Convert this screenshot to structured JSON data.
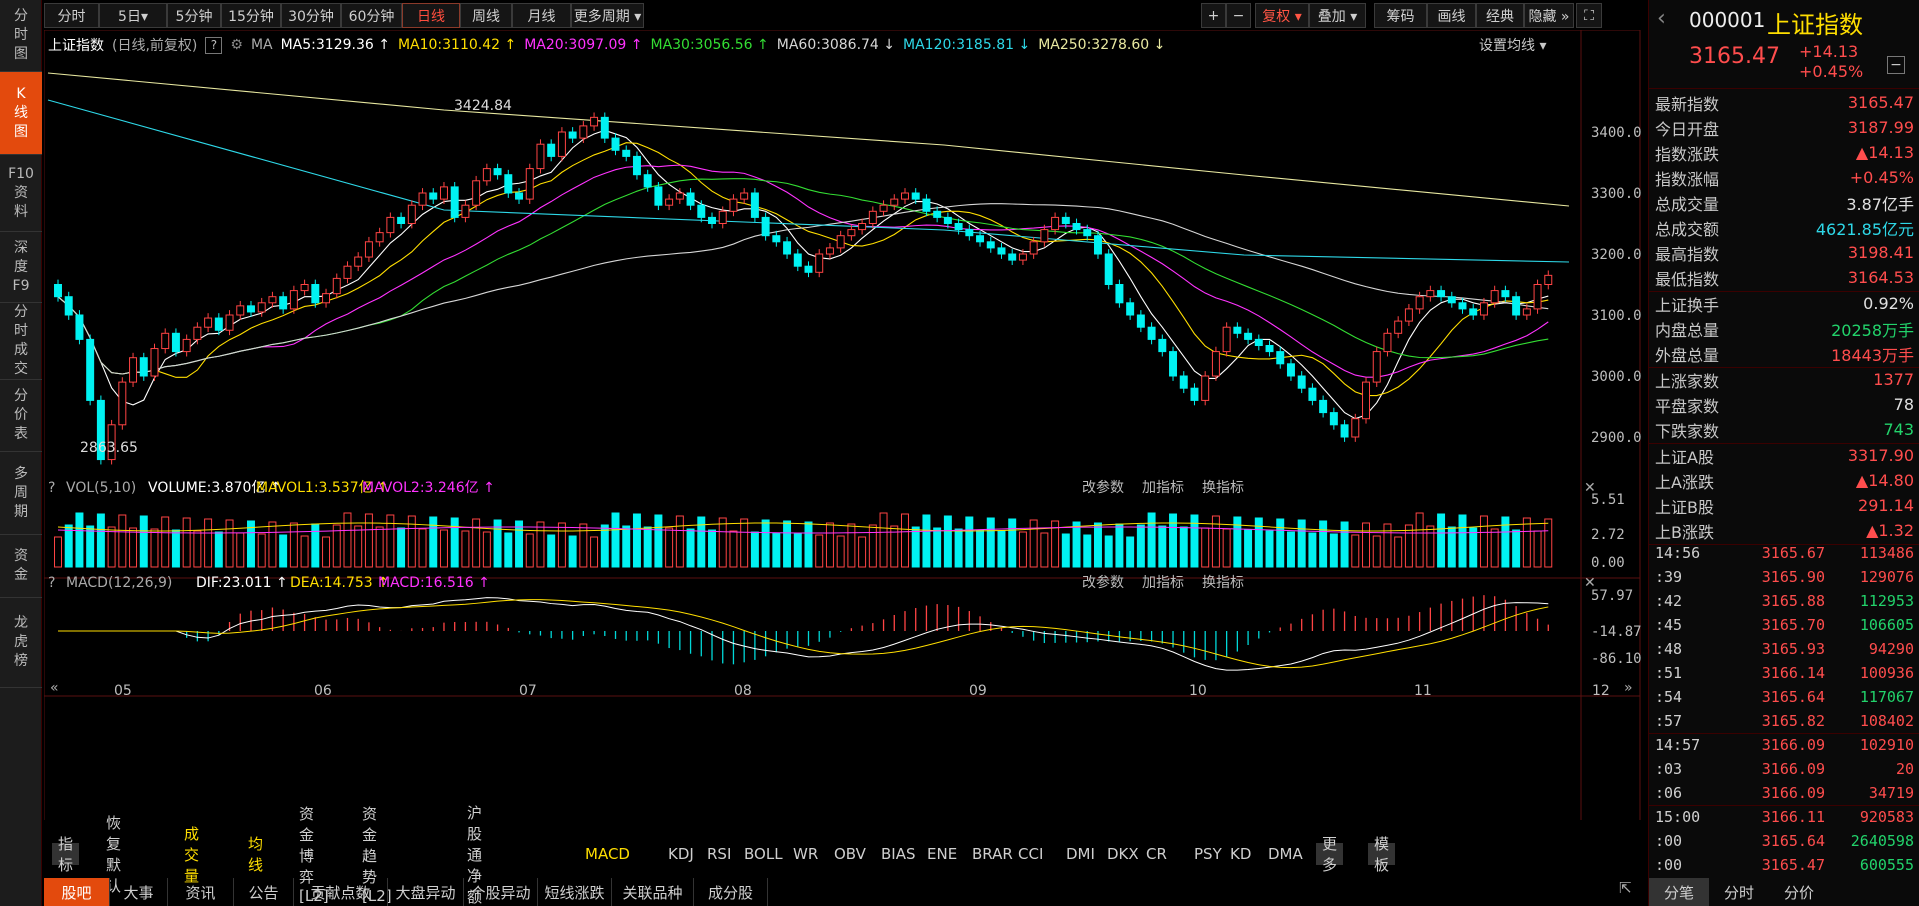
{
  "left_nav": [
    "分\n时\n图",
    "K\n线\n图",
    "F10\n资\n料",
    "深\n度\nF9",
    "分\n时\n成\n交",
    "分\n价\n表",
    "多\n周\n期",
    "资\n金",
    "龙\n虎\n榜"
  ],
  "toolbar": {
    "items": [
      "分时",
      "5日▾",
      "5分钟",
      "15分钟",
      "30分钟",
      "60分钟",
      "日线",
      "周线",
      "月线",
      "更多周期 ▾"
    ],
    "right": [
      "+",
      "−",
      "复权 ▾",
      "叠加 ▾",
      "筹码",
      "画线",
      "经典",
      "隐藏 »"
    ]
  },
  "main_header": {
    "name": "上证指数",
    "mode": "(日线,前复权)",
    "ma_label": "MA",
    "ma": [
      {
        "t": "MA5:3129.36 ↑",
        "c": "#ffffff"
      },
      {
        "t": "MA10:3110.42 ↑",
        "c": "#ffde00"
      },
      {
        "t": "MA20:3097.09 ↑",
        "c": "#ff33ff"
      },
      {
        "t": "MA30:3056.56 ↑",
        "c": "#33dd33"
      },
      {
        "t": "MA60:3086.74 ↓",
        "c": "#d6d6d6"
      },
      {
        "t": "MA120:3185.81 ↓",
        "c": "#2ed8e8"
      },
      {
        "t": "MA250:3278.60 ↓",
        "c": "#e8e8a0"
      }
    ],
    "settings": "设置均线 ▾"
  },
  "price_axis": [
    "3400.00",
    "3300.00",
    "3200.00",
    "3100.00",
    "3000.00",
    "2900.00"
  ],
  "annotations": {
    "high": "3424.84",
    "low": "2863.65"
  },
  "vol_header": {
    "label": "VOL(5,10)",
    "volume": "VOLUME:3.870亿 ↑",
    "mavol1": "MAVOL1:3.537亿 ↑",
    "mavol2": "MAVOL2:3.246亿 ↑"
  },
  "vol_axis": [
    "5.51",
    "2.72",
    "0.00"
  ],
  "macd_header": {
    "label": "MACD(12,26,9)",
    "dif": "DIF:23.011 ↑",
    "dea": "DEA:14.753 ↑",
    "macd": "MACD:16.516 ↑"
  },
  "macd_axis": [
    "57.97",
    "-14.87",
    "-86.10"
  ],
  "panel_actions": [
    "改参数",
    "加指标",
    "换指标"
  ],
  "x_axis": [
    "05",
    "06",
    "07",
    "08",
    "09",
    "10",
    "11",
    "12"
  ],
  "indicator_tabs": [
    "指标",
    "恢复默认",
    "成交量",
    "均线",
    "资金博弈[L2]",
    "资金趋势[L2]",
    "沪股通净额",
    "MACD",
    "KDJ",
    "RSI",
    "BOLL",
    "WR",
    "OBV",
    "BIAS",
    "ENE",
    "BRAR",
    "CCI",
    "DMI",
    "DKX",
    "CR",
    "PSY",
    "KD",
    "DMA",
    "更多",
    "模板"
  ],
  "bottom_tabs": [
    "股吧",
    "大事",
    "资讯",
    "公告",
    "贡献点数",
    "大盘异动",
    "个股异动",
    "短线涨跌",
    "关联品种",
    "成分股"
  ],
  "right_panel": {
    "code": "000001",
    "name": "上证指数",
    "price": "3165.47",
    "change": "+14.13",
    "pct": "+0.45%",
    "rows1": [
      [
        "最新指数",
        "3165.47",
        "up"
      ],
      [
        "今日开盘",
        "3187.99",
        "up"
      ],
      [
        "指数涨跌",
        "▲14.13",
        "up"
      ],
      [
        "指数涨幅",
        "+0.45%",
        "up"
      ],
      [
        "总成交量",
        "3.87亿手",
        "w"
      ],
      [
        "总成交额",
        "4621.85亿元",
        "cy"
      ],
      [
        "最高指数",
        "3198.41",
        "up"
      ],
      [
        "最低指数",
        "3164.53",
        "up"
      ]
    ],
    "rows2": [
      [
        "上证换手",
        "0.92%",
        "w"
      ],
      [
        "内盘总量",
        "20258万手",
        "dn"
      ],
      [
        "外盘总量",
        "18443万手",
        "up"
      ]
    ],
    "rows3": [
      [
        "上涨家数",
        "1377",
        "up"
      ],
      [
        "平盘家数",
        "78",
        "w"
      ],
      [
        "下跌家数",
        "743",
        "dn"
      ]
    ],
    "rows4": [
      [
        "上证A股",
        "3317.90",
        "up"
      ],
      [
        "上A涨跌",
        "▲14.80",
        "up"
      ],
      [
        "上证B股",
        "291.14",
        "up"
      ],
      [
        "上B涨跌",
        "▲1.32",
        "up"
      ]
    ],
    "ticks": [
      [
        "14:56",
        "3165.67",
        "113486",
        "up"
      ],
      [
        ":39",
        "3165.90",
        "129076",
        "up"
      ],
      [
        ":42",
        "3165.88",
        "112953",
        "dn"
      ],
      [
        ":45",
        "3165.70",
        "106605",
        "dn"
      ],
      [
        ":48",
        "3165.93",
        "94290",
        "up"
      ],
      [
        ":51",
        "3166.14",
        "100936",
        "up"
      ],
      [
        ":54",
        "3165.64",
        "117067",
        "dn"
      ],
      [
        ":57",
        "3165.82",
        "108402",
        "up"
      ],
      [
        "14:57",
        "3166.09",
        "102910",
        "up"
      ],
      [
        ":03",
        "3166.09",
        "20",
        "up"
      ],
      [
        ":06",
        "3166.09",
        "34719",
        "up"
      ],
      [
        "15:00",
        "3166.11",
        "920583",
        "up"
      ],
      [
        ":00",
        "3165.64",
        "2640598",
        "dn"
      ],
      [
        ":00",
        "3165.47",
        "600555",
        "dn"
      ]
    ],
    "tabs": [
      "分笔",
      "分时",
      "分价"
    ]
  },
  "chart_data": {
    "type": "candlestick",
    "closes": [
      3130,
      3100,
      3060,
      2960,
      2863,
      2920,
      2990,
      3030,
      3000,
      3045,
      3070,
      3040,
      3060,
      3080,
      3095,
      3075,
      3100,
      3115,
      3105,
      3120,
      3130,
      3110,
      3140,
      3150,
      3120,
      3135,
      3160,
      3180,
      3195,
      3220,
      3235,
      3260,
      3250,
      3280,
      3300,
      3290,
      3310,
      3260,
      3280,
      3320,
      3340,
      3330,
      3300,
      3290,
      3340,
      3380,
      3360,
      3400,
      3390,
      3410,
      3424,
      3390,
      3370,
      3360,
      3330,
      3310,
      3280,
      3290,
      3300,
      3280,
      3260,
      3250,
      3270,
      3290,
      3300,
      3260,
      3230,
      3220,
      3200,
      3180,
      3170,
      3200,
      3210,
      3230,
      3240,
      3250,
      3270,
      3280,
      3290,
      3300,
      3290,
      3270,
      3260,
      3250,
      3240,
      3230,
      3220,
      3210,
      3200,
      3190,
      3200,
      3220,
      3240,
      3260,
      3250,
      3240,
      3230,
      3200,
      3150,
      3120,
      3100,
      3080,
      3060,
      3040,
      3000,
      2980,
      2960,
      3000,
      3040,
      3080,
      3070,
      3060,
      3050,
      3040,
      3020,
      3000,
      2980,
      2960,
      2940,
      2920,
      2900,
      2930,
      2990,
      3040,
      3070,
      3090,
      3110,
      3130,
      3140,
      3130,
      3120,
      3110,
      3100,
      3120,
      3140,
      3130,
      3100,
      3110,
      3150,
      3165
    ]
  }
}
